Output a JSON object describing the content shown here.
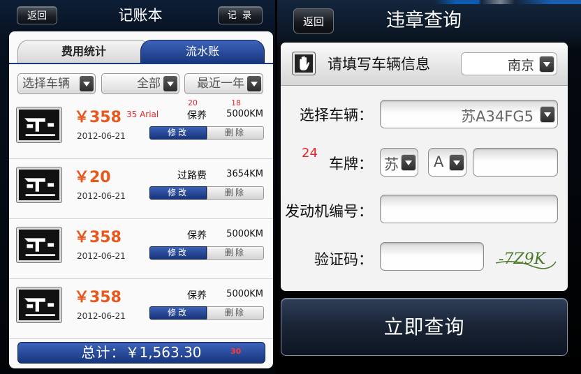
{
  "left": {
    "back_label": "返回",
    "title": "记账本",
    "record_label": "记 录",
    "tabs": [
      "费用统计",
      "流水账"
    ],
    "filters": [
      "选择车辆",
      "全部",
      "最近一年"
    ],
    "records": [
      {
        "amount": "￥358",
        "date": "2012-06-21",
        "type": "保养",
        "km": "5000KM",
        "edit": "修改",
        "delete": "删除",
        "annotations": {
          "size": "35 Arial",
          "type_size": "20",
          "km_size": "18"
        }
      },
      {
        "amount": "￥20",
        "date": "2012-06-21",
        "type": "过路费",
        "km": "3654KM",
        "edit": "修改",
        "delete": "删除"
      },
      {
        "amount": "￥358",
        "date": "2012-06-21",
        "type": "保养",
        "km": "5000KM",
        "edit": "修改",
        "delete": "删除"
      },
      {
        "amount": "￥358",
        "date": "2012-06-21",
        "type": "保养",
        "km": "5000KM",
        "edit": "修改",
        "delete": "删除"
      }
    ],
    "total_label": "总计：",
    "total_value": "￥1,563.30",
    "total_annotation": "30"
  },
  "right": {
    "back_label": "返回",
    "title": "违章查询",
    "section_label": "请填写车辆信息",
    "city": "南京",
    "vehicle_label": "选择车辆：",
    "vehicle_value": "苏A34FG5",
    "plate_label": "车牌：",
    "plate_province": "苏",
    "plate_letter": "A",
    "plate_annotation": "24",
    "engine_label": "发动机编号：",
    "captcha_label": "验证码：",
    "captcha_text": "-7Z9K",
    "query_button": "立即查询"
  }
}
